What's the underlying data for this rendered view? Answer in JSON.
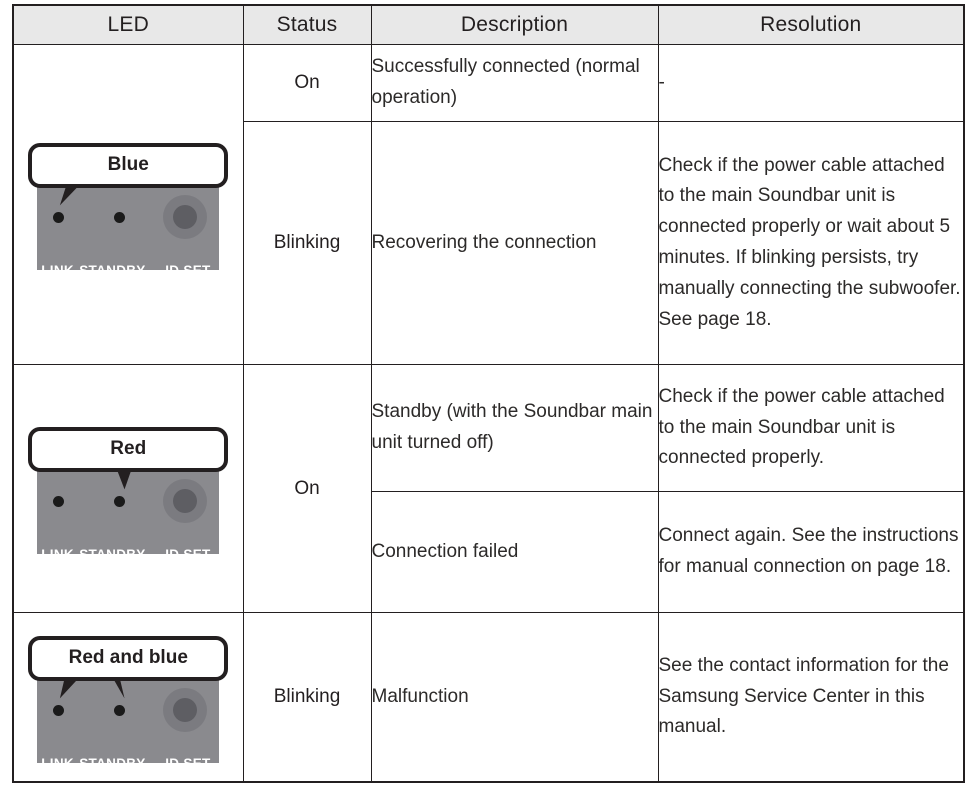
{
  "table": {
    "headers": [
      "LED",
      "Status",
      "Description",
      "Resolution"
    ],
    "rows": [
      {
        "led": {
          "callout_label": "Blue",
          "panel_labels": [
            "LINK",
            "STANDBY",
            "ID SET"
          ],
          "pointers": [
            "LINK"
          ],
          "panel_color": "#8a8a8e",
          "led_color": "#1a1a1a"
        },
        "entries": [
          {
            "status": "On",
            "description": "Successfully connected (normal operation)",
            "resolution": "-"
          },
          {
            "status": "Blinking",
            "description": "Recovering the connection",
            "resolution": "Check if the power cable attached to the main Soundbar unit is connected properly or wait about 5 minutes. If blinking persists, try manually connecting the subwoofer. See page 18."
          }
        ]
      },
      {
        "led": {
          "callout_label": "Red",
          "panel_labels": [
            "LINK",
            "STANDBY",
            "ID SET"
          ],
          "pointers": [
            "STANDBY"
          ],
          "panel_color": "#8a8a8e",
          "led_color": "#1a1a1a"
        },
        "entries": [
          {
            "status": "On",
            "description": "Standby (with the Soundbar main unit turned off)",
            "resolution": "Check if the power cable attached to the main Soundbar unit is connected properly."
          },
          {
            "status": "",
            "description": "Connection failed",
            "resolution": "Connect again. See the instructions for manual connection on page 18."
          }
        ]
      },
      {
        "led": {
          "callout_label": "Red and blue",
          "panel_labels": [
            "LINK",
            "STANDBY",
            "ID SET"
          ],
          "pointers": [
            "LINK",
            "STANDBY"
          ],
          "panel_color": "#8a8a8e",
          "led_color": "#1a1a1a"
        },
        "entries": [
          {
            "status": "Blinking",
            "description": "Malfunction",
            "resolution": "See the contact information for the Samsung Service Center in this manual."
          }
        ]
      }
    ]
  },
  "colors": {
    "header_bg": "#e8e8e8",
    "border": "#231f20",
    "text": "#231f20",
    "panel": "#8a8a8e"
  }
}
